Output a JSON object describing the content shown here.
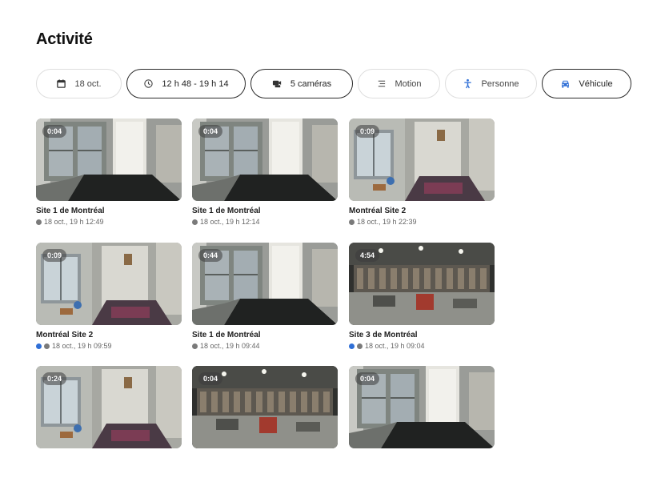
{
  "page_title": "Activité",
  "filters": [
    {
      "label": "18 oct.",
      "icon": "calendar-icon",
      "active": false
    },
    {
      "label": "12 h 48 - 19 h 14",
      "icon": "clock-icon",
      "active": true
    },
    {
      "label": "5 caméras",
      "icon": "cameras-icon",
      "active": true
    },
    {
      "label": "Motion",
      "icon": "motion-icon",
      "active": false
    },
    {
      "label": "Personne",
      "icon": "person-icon",
      "active": false
    },
    {
      "label": "Véhicule",
      "icon": "vehicle-icon",
      "active": true
    }
  ],
  "colors": {
    "accent_blue": "#2f6fd6",
    "dot_gray": "#7a7a7a",
    "text_dark": "#1a1a1a"
  },
  "clips": [
    {
      "duration": "0:04",
      "title": "Site 1 de Montréal",
      "meta": "18 oct., 19 h 12:49",
      "scene": "door-dark",
      "dots": [
        "gray"
      ]
    },
    {
      "duration": "0:04",
      "title": "Site 1 de Montréal",
      "meta": "18 oct., 19 h 12:14",
      "scene": "door-dark",
      "dots": [
        "gray"
      ]
    },
    {
      "duration": "0:09",
      "title": "Montréal Site 2",
      "meta": "18 oct., 19 h 22:39",
      "scene": "entry-rug",
      "dots": [
        "gray"
      ]
    },
    {
      "duration": "0:09",
      "title": "Montréal Site 2",
      "meta": "18 oct., 19 h 09:59",
      "scene": "entry-rug",
      "dots": [
        "blue",
        "gray"
      ]
    },
    {
      "duration": "0:44",
      "title": "Site 1 de Montréal",
      "meta": "18 oct., 19 h 09:44",
      "scene": "door-dark",
      "dots": [
        "gray"
      ]
    },
    {
      "duration": "4:54",
      "title": "Site 3 de Montréal",
      "meta": "18 oct., 19 h 09:04",
      "scene": "warehouse",
      "dots": [
        "blue",
        "gray"
      ]
    },
    {
      "duration": "0:24",
      "title": "",
      "meta": "",
      "scene": "entry-rug",
      "dots": []
    },
    {
      "duration": "0:04",
      "title": "",
      "meta": "",
      "scene": "warehouse",
      "dots": []
    },
    {
      "duration": "0:04",
      "title": "",
      "meta": "",
      "scene": "door-dark",
      "dots": []
    }
  ]
}
